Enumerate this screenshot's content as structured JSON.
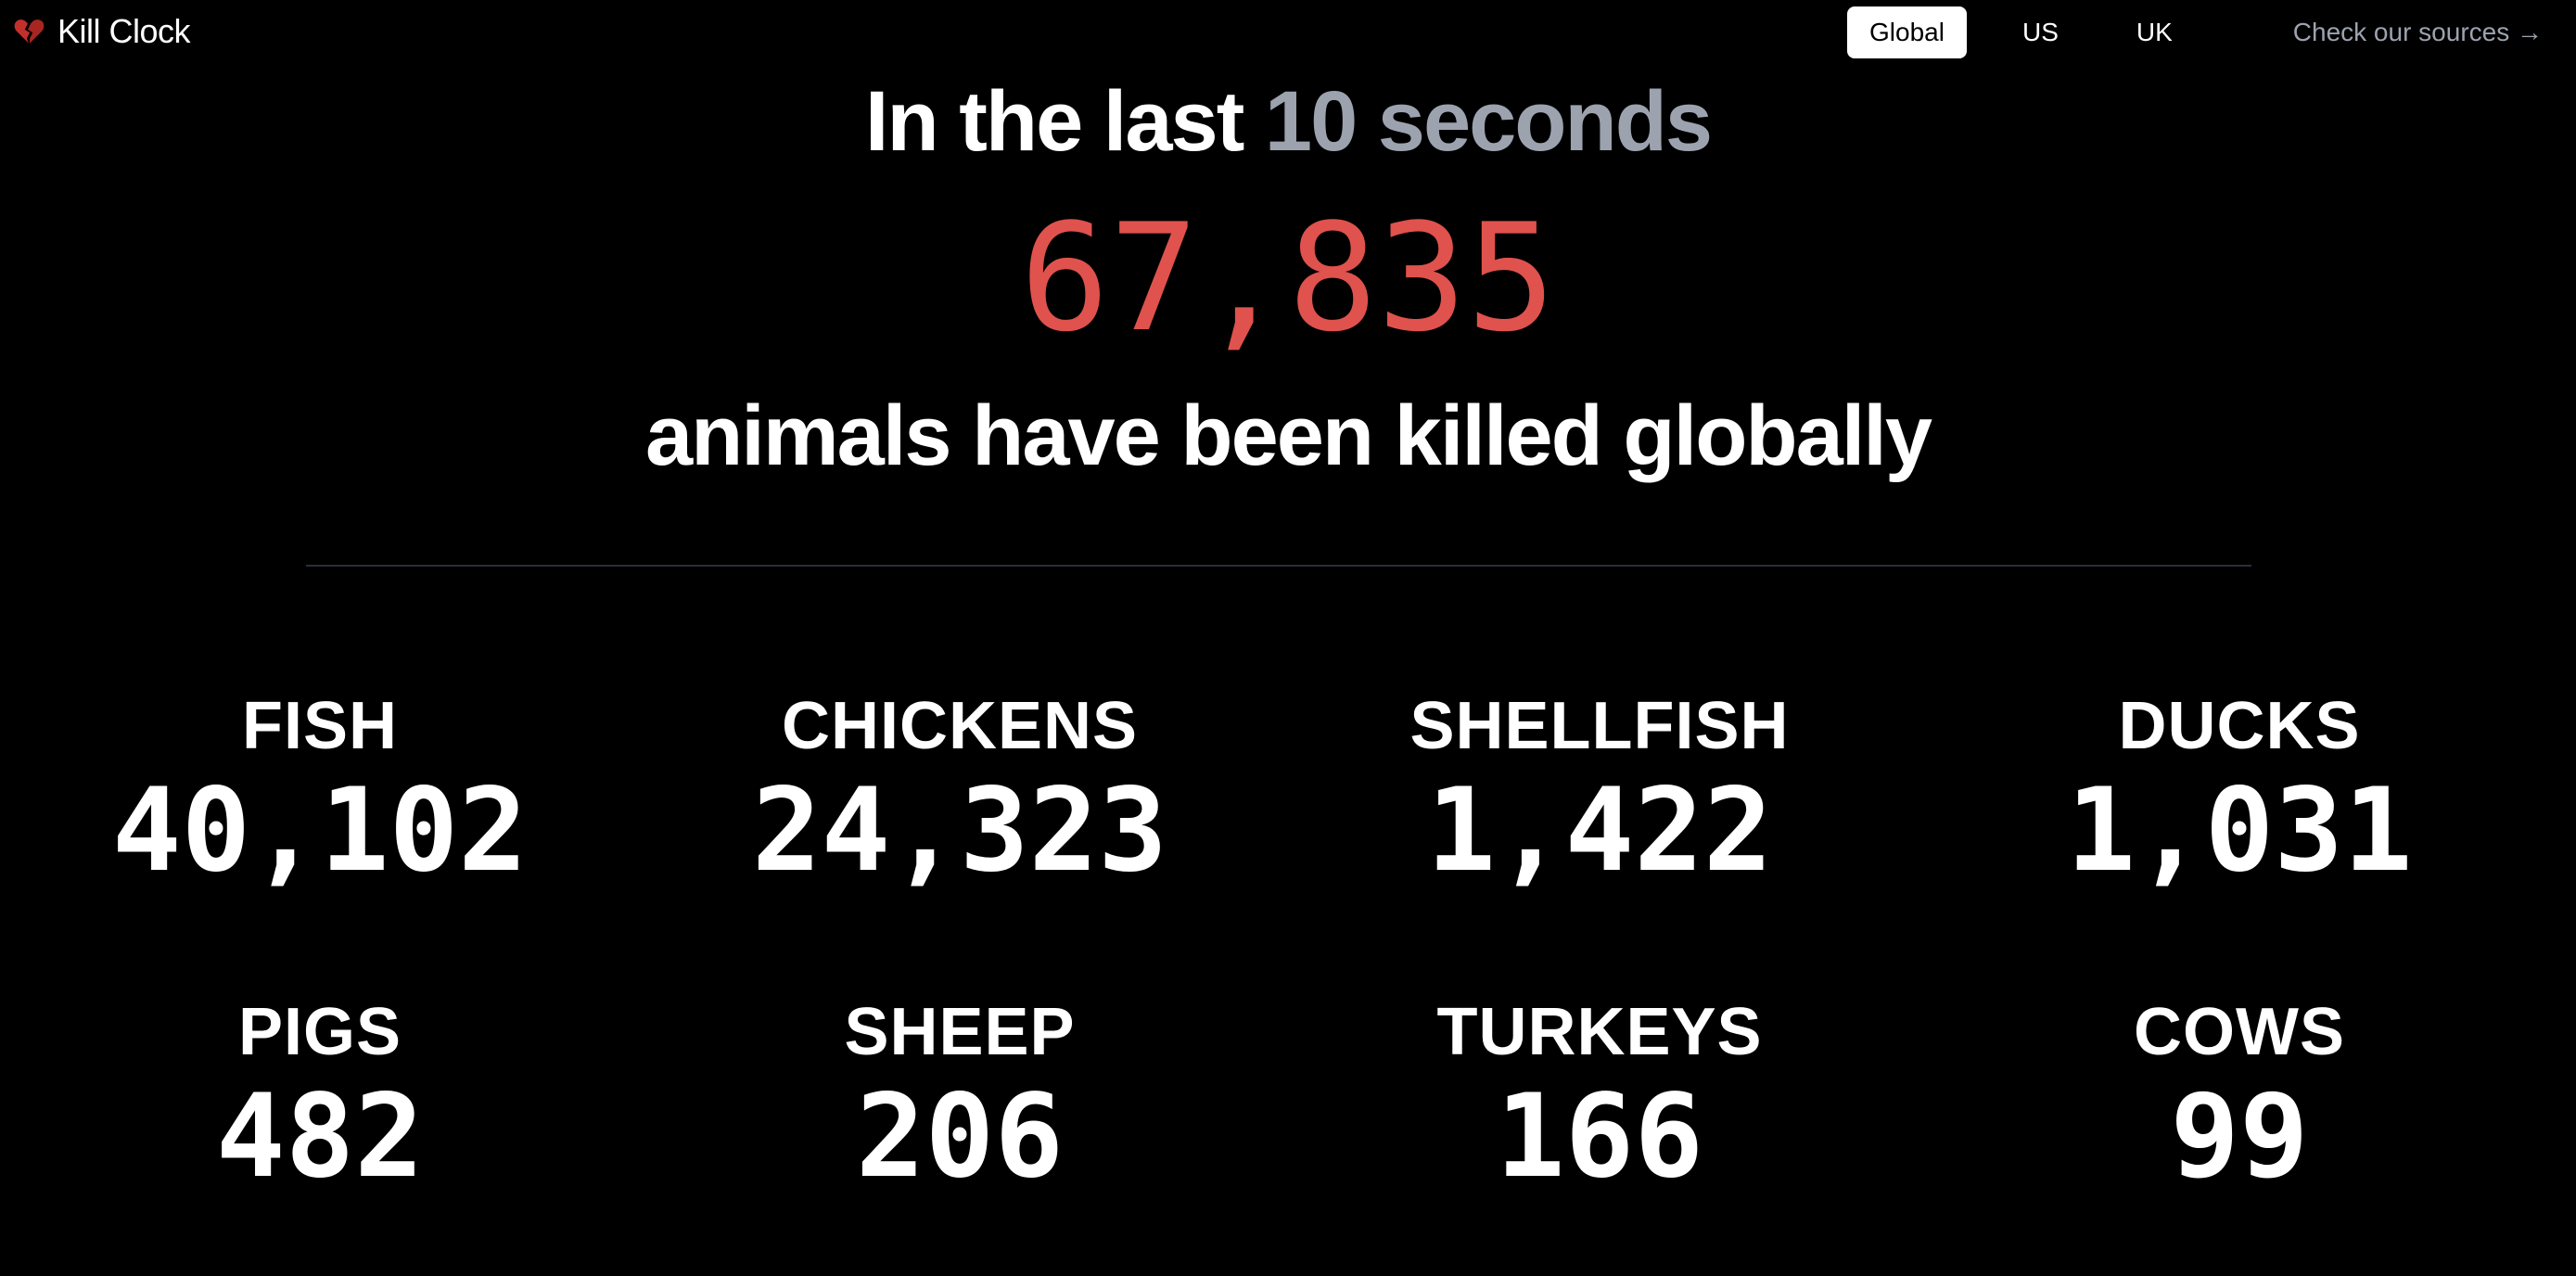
{
  "brand": {
    "name": "Kill Clock",
    "icon": "broken-heart-icon"
  },
  "nav": {
    "tabs": [
      {
        "label": "Global",
        "active": true
      },
      {
        "label": "US",
        "active": false
      },
      {
        "label": "UK",
        "active": false
      }
    ],
    "sources_label": "Check our sources →"
  },
  "hero": {
    "prefix": "In the last",
    "period": "10 seconds",
    "total": "67,835",
    "subtitle": "animals have been killed globally"
  },
  "animals": [
    {
      "name": "FISH",
      "count": "40,102"
    },
    {
      "name": "CHICKENS",
      "count": "24,323"
    },
    {
      "name": "SHELLFISH",
      "count": "1,422"
    },
    {
      "name": "DUCKS",
      "count": "1,031"
    },
    {
      "name": "PIGS",
      "count": "482"
    },
    {
      "name": "SHEEP",
      "count": "206"
    },
    {
      "name": "TURKEYS",
      "count": "166"
    },
    {
      "name": "COWS",
      "count": "99"
    }
  ],
  "colors": {
    "background": "#000000",
    "accent_red": "#e0524d",
    "muted": "#9ca3af",
    "divider": "#2a2f3a"
  }
}
